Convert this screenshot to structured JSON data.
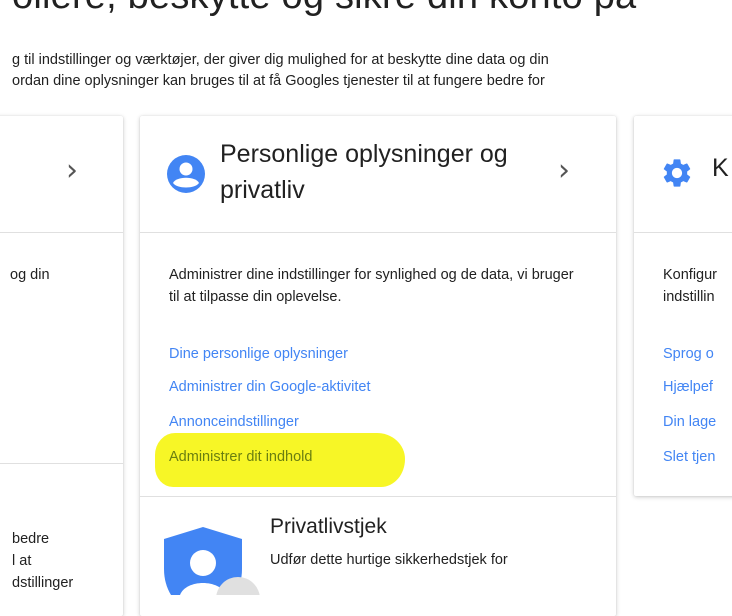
{
  "header": {
    "title": "ollere, beskytte og sikre din konto på",
    "intro_line1": "g til indstillinger og værktøjer, der giver dig mulighed for at beskytte dine data og din",
    "intro_line2": "ordan dine oplysninger kan bruges til at få Googles tjenester til at fungere bedre for"
  },
  "cards": {
    "left": {
      "desc_fragment": "og din",
      "lower_lines": [
        "bedre",
        "l at",
        "dstillinger"
      ]
    },
    "middle": {
      "title": "Personlige oplysninger og privatliv",
      "description": "Administrer dine indstillinger for synlighed og de data, vi bruger til at tilpasse din oplevelse.",
      "links": [
        "Dine personlige oplysninger",
        "Administrer din Google-aktivitet",
        "Annonceindstillinger",
        "Administrer dit indhold"
      ],
      "privacy_check": {
        "title": "Privatlivstjek",
        "description": "Udfør dette hurtige sikkerhedstjek for"
      }
    },
    "right": {
      "title_fragment": "K",
      "desc_lines": [
        "Konfigur",
        "indstillin"
      ],
      "links": [
        "Sprog o",
        "Hjælpef",
        "Din lage",
        "Slet tjen"
      ]
    }
  },
  "colors": {
    "link": "#4285f4",
    "highlight": "#f7f51a",
    "icon_blue": "#4285f4"
  }
}
